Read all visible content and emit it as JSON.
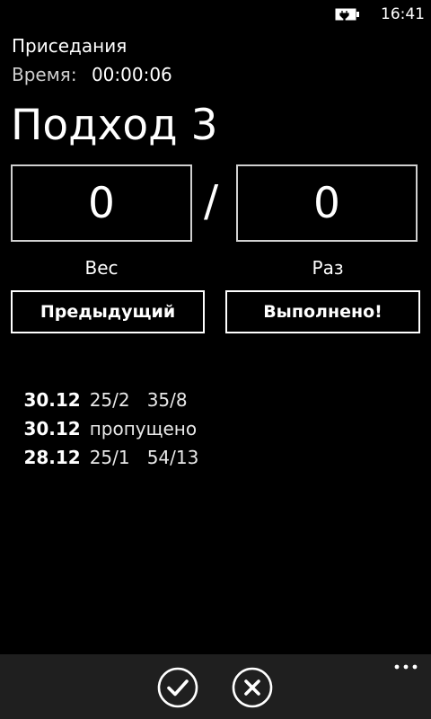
{
  "status_bar": {
    "time": "16:41",
    "battery_icon": "battery-charging-icon"
  },
  "header": {
    "exercise_name": "Приседания",
    "time_label": "Время:",
    "time_value": "00:00:06"
  },
  "set": {
    "title": "Подход 3",
    "weight_value": "0",
    "separator": "/",
    "reps_value": "0",
    "weight_label": "Вес",
    "reps_label": "Раз"
  },
  "buttons": {
    "previous_label": "Предыдущий",
    "done_label": "Выполнено!"
  },
  "history": [
    {
      "date": "30.12",
      "c1": "25/2",
      "c2": "35/8"
    },
    {
      "date": "30.12",
      "c1": "пропущено",
      "c2": ""
    },
    {
      "date": "28.12",
      "c1": "25/1",
      "c2": "54/13"
    }
  ],
  "app_bar": {
    "buttons": [
      {
        "icon": "check-icon"
      },
      {
        "icon": "close-icon"
      }
    ],
    "more_icon": "more-ellipsis-icon"
  },
  "colors": {
    "background": "#000000",
    "foreground": "#ffffff",
    "box_border": "#d0d0d0",
    "app_bar_bg": "#1f1f1f"
  }
}
